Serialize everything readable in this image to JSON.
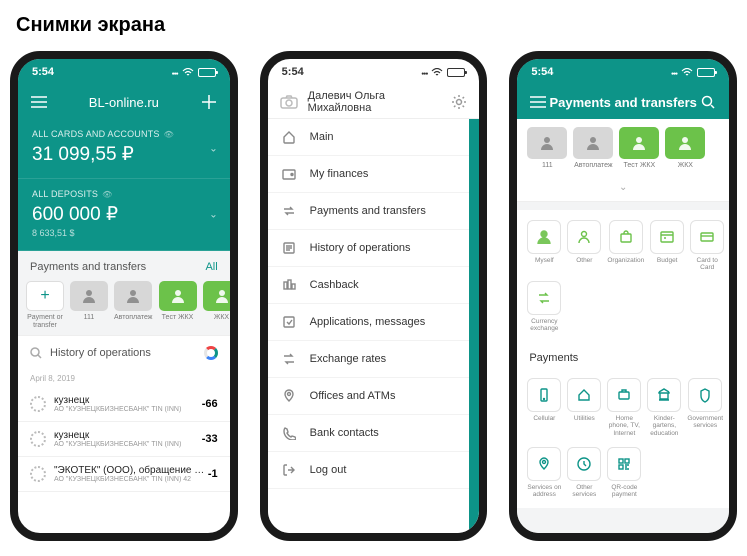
{
  "page_heading": "Снимки экрана",
  "status": {
    "time": "5:54"
  },
  "screen1": {
    "title": "BL-online.ru",
    "accounts": {
      "label": "ALL CARDS AND ACCOUNTS",
      "value": "31 099,55 ₽"
    },
    "deposits": {
      "label": "ALL DEPOSITS",
      "value": "600 000 ₽",
      "sub": "8 633,51 $"
    },
    "payments_section": {
      "title": "Payments and transfers",
      "all": "All"
    },
    "quick_cards": [
      {
        "caption": "Payment or transfer",
        "icon": "+",
        "style": "add"
      },
      {
        "caption": "111",
        "icon": "person",
        "style": "grey"
      },
      {
        "caption": "Автоплатеж",
        "icon": "person",
        "style": "grey"
      },
      {
        "caption": "Тест ЖКХ",
        "icon": "person",
        "style": "green"
      },
      {
        "caption": "ЖКХ",
        "icon": "person",
        "style": "green"
      }
    ],
    "history_label": "History of operations",
    "date": "April 8, 2019",
    "operations": [
      {
        "title": "кузнецк",
        "sub": "АО \"КУЗНЕЦКБИЗНЕСБАНК\" TIN (INN)",
        "amount": "-66"
      },
      {
        "title": "кузнецк",
        "sub": "АО \"КУЗНЕЦКБИЗНЕСБАНК\" TIN (INN)",
        "amount": "-33"
      },
      {
        "title": "\"ЭКОТЕК\" (ООО), обращение с тко",
        "sub": "АО \"КУЗНЕЦКБИЗНЕСБАНК\" TIN (INN) 42",
        "amount": "-1"
      }
    ]
  },
  "screen2": {
    "user_name": "Далевич Ольга Михайловна",
    "menu": [
      {
        "icon": "home",
        "label": "Main"
      },
      {
        "icon": "wallet",
        "label": "My finances"
      },
      {
        "icon": "transfer",
        "label": "Payments and transfers"
      },
      {
        "icon": "history",
        "label": "History of operations"
      },
      {
        "icon": "cashback",
        "label": "Cashback"
      },
      {
        "icon": "apps",
        "label": "Applications, messages"
      },
      {
        "icon": "rates",
        "label": "Exchange rates"
      },
      {
        "icon": "offices",
        "label": "Offices and ATMs"
      },
      {
        "icon": "contacts",
        "label": "Bank contacts"
      },
      {
        "icon": "logout",
        "label": "Log out"
      }
    ]
  },
  "screen3": {
    "title": "Payments and transfers",
    "top_cards": [
      {
        "caption": "111",
        "style": "grey"
      },
      {
        "caption": "Автоплатеж",
        "style": "grey"
      },
      {
        "caption": "Тест ЖКХ",
        "style": "green"
      },
      {
        "caption": "ЖКХ",
        "style": "green"
      }
    ],
    "group1": [
      {
        "caption": "Myself"
      },
      {
        "caption": "Other"
      },
      {
        "caption": "Organization"
      },
      {
        "caption": "Budget"
      },
      {
        "caption": "Card to Card"
      }
    ],
    "group1b": [
      {
        "caption": "Currency exchange"
      }
    ],
    "payments_title": "Payments",
    "group2": [
      {
        "caption": "Cellular"
      },
      {
        "caption": "Utilities"
      },
      {
        "caption": "Home phone, TV, Internet"
      },
      {
        "caption": "Kinder-gartens, education"
      },
      {
        "caption": "Government services"
      }
    ],
    "group3": [
      {
        "caption": "Services on address"
      },
      {
        "caption": "Other services"
      },
      {
        "caption": "QR-code payment"
      }
    ]
  }
}
